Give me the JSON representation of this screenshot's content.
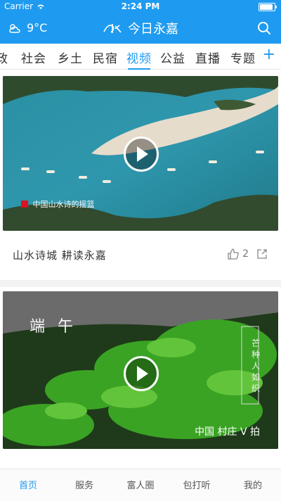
{
  "status_bar": {
    "carrier": "Carrier",
    "time": "2:24 PM"
  },
  "header": {
    "weather": "9°C",
    "title": "今日永嘉",
    "icons": {
      "weather": "cloud-sun-icon",
      "search": "search-icon",
      "logo": "app-logo"
    }
  },
  "tabs": {
    "items": [
      "政",
      "社会",
      "乡土",
      "民宿",
      "视频",
      "公益",
      "直播",
      "专题"
    ],
    "active": "视频",
    "add_label": "+"
  },
  "cards": [
    {
      "title": "山水诗城 耕读永嘉",
      "likes": "2",
      "overlay_caption": "中国山水诗的摇篮"
    },
    {
      "overlay_title": "端午",
      "overlay_vertical": "芒种人如织",
      "overlay_brand": "中国 村庄 V 拍"
    }
  ],
  "bottom_nav": {
    "items": [
      "首页",
      "服务",
      "富人圈",
      "包打听",
      "我的"
    ],
    "active": "首页"
  },
  "colors": {
    "accent": "#1e9bf0"
  }
}
